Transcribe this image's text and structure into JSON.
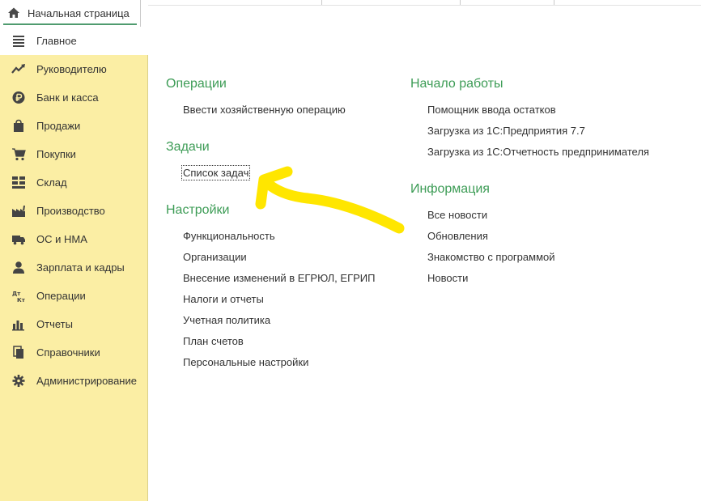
{
  "tabs": {
    "home_label": "Начальная страница",
    "home_icon": "home-icon"
  },
  "sidebar": {
    "items": [
      {
        "label": "Главное",
        "icon": "menu-lines-icon",
        "active": true
      },
      {
        "label": "Руководителю",
        "icon": "trend-chart-icon",
        "active": false
      },
      {
        "label": "Банк и касса",
        "icon": "ruble-coin-icon",
        "active": false
      },
      {
        "label": "Продажи",
        "icon": "shopping-bag-icon",
        "active": false
      },
      {
        "label": "Покупки",
        "icon": "cart-icon",
        "active": false
      },
      {
        "label": "Склад",
        "icon": "warehouse-grid-icon",
        "active": false
      },
      {
        "label": "Производство",
        "icon": "factory-icon",
        "active": false
      },
      {
        "label": "ОС и НМА",
        "icon": "truck-icon",
        "active": false
      },
      {
        "label": "Зарплата и кадры",
        "icon": "person-icon",
        "active": false
      },
      {
        "label": "Операции",
        "icon": "debit-credit-icon",
        "active": false
      },
      {
        "label": "Отчеты",
        "icon": "bar-chart-icon",
        "active": false
      },
      {
        "label": "Справочники",
        "icon": "books-icon",
        "active": false
      },
      {
        "label": "Администрирование",
        "icon": "gear-icon",
        "active": false
      }
    ]
  },
  "main": {
    "left_column": {
      "operations": {
        "title": "Операции",
        "links": [
          "Ввести хозяйственную операцию"
        ]
      },
      "tasks": {
        "title": "Задачи",
        "links": [
          "Список задач"
        ]
      },
      "settings": {
        "title": "Настройки",
        "links": [
          "Функциональность",
          "Организации",
          "Внесение изменений в ЕГРЮЛ, ЕГРИП",
          "Налоги и отчеты",
          "Учетная политика",
          "План счетов",
          "Персональные настройки"
        ]
      }
    },
    "right_column": {
      "start": {
        "title": "Начало работы",
        "links": [
          "Помощник ввода остатков",
          "Загрузка из 1С:Предприятия 7.7",
          "Загрузка из 1С:Отчетность предпринимателя"
        ]
      },
      "info": {
        "title": "Информация",
        "links": [
          "Все новости",
          "Обновления",
          "Знакомство с программой",
          "Новости"
        ]
      }
    }
  },
  "colors": {
    "sidebar_bg": "#fbeea4",
    "section_title": "#3d9c56",
    "tab_underline": "#4f9b6f",
    "annotation_arrow": "#ffe600"
  }
}
